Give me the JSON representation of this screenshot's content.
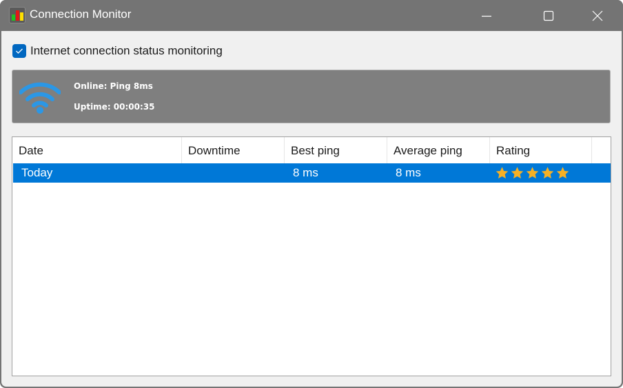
{
  "window": {
    "title": "Connection Monitor",
    "controls": {
      "minimize": "minimize-icon",
      "maximize": "maximize-icon",
      "close": "close-icon"
    }
  },
  "monitor": {
    "checkbox_label": "Internet connection status monitoring",
    "checked": true
  },
  "status": {
    "icon": "wifi-icon",
    "online_text": "Online: Ping 8ms",
    "uptime_text": "Uptime: 00:00:35"
  },
  "table": {
    "columns": [
      "Date",
      "Downtime",
      "Best ping",
      "Average ping",
      "Rating"
    ],
    "rows": [
      {
        "date": "Today",
        "downtime": "",
        "best_ping": "8 ms",
        "average_ping": "8 ms",
        "rating": 5,
        "rating_max": 5,
        "selected": true
      }
    ]
  },
  "colors": {
    "selection": "#0078d7",
    "star": "#f5b026",
    "checkbox": "#0067c0",
    "titlebar": "#747474",
    "status_panel": "#7f7f7f",
    "wifi": "#2b97e6"
  }
}
